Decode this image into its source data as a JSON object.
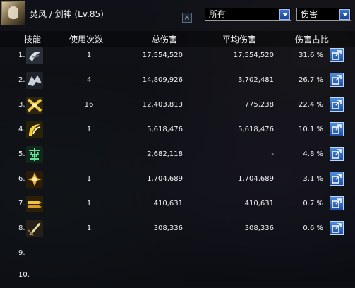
{
  "header": {
    "character_name": "焚风  /  剑神  (Lv.85)",
    "filter_select": "所有",
    "sort_select": "伤害",
    "close_symbol": "×"
  },
  "columns": {
    "skill": "技能",
    "count": "使用次数",
    "total": "总伤害",
    "avg": "平均伤害",
    "pct": "伤害占比"
  },
  "rows": [
    {
      "rank": "1.",
      "icon": "ghost-slash-icon",
      "count": "1",
      "total": "17,554,520",
      "avg": "17,554,520",
      "pct": "31.6  %",
      "has_data": true
    },
    {
      "rank": "2.",
      "icon": "wolf-fang-icon",
      "count": "4",
      "total": "14,809,926",
      "avg": "3,702,481",
      "pct": "26.7  %",
      "has_data": true
    },
    {
      "rank": "3.",
      "icon": "cross-blade-icon",
      "count": "16",
      "total": "12,403,813",
      "avg": "775,238",
      "pct": "22.4  %",
      "has_data": true
    },
    {
      "rank": "4.",
      "icon": "arc-slash-icon",
      "count": "1",
      "total": "5,618,476",
      "avg": "5,618,476",
      "pct": "10.1  %",
      "has_data": true
    },
    {
      "rank": "5.",
      "icon": "glyph-icon",
      "count": "",
      "total": "2,682,118",
      "avg": "-",
      "pct": "4.8  %",
      "has_data": true
    },
    {
      "rank": "6.",
      "icon": "flame-burst-icon",
      "count": "1",
      "total": "1,704,689",
      "avg": "1,704,689",
      "pct": "3.1  %",
      "has_data": true
    },
    {
      "rank": "7.",
      "icon": "dual-strike-icon",
      "count": "1",
      "total": "410,631",
      "avg": "410,631",
      "pct": "0.7  %",
      "has_data": true
    },
    {
      "rank": "8.",
      "icon": "phantom-sword-icon",
      "count": "1",
      "total": "308,336",
      "avg": "308,336",
      "pct": "0.6  %",
      "has_data": true
    },
    {
      "rank": "9.",
      "icon": "",
      "count": "",
      "total": "",
      "avg": "",
      "pct": "",
      "has_data": false
    },
    {
      "rank": "10.",
      "icon": "",
      "count": "",
      "total": "",
      "avg": "",
      "pct": "",
      "has_data": false
    }
  ]
}
